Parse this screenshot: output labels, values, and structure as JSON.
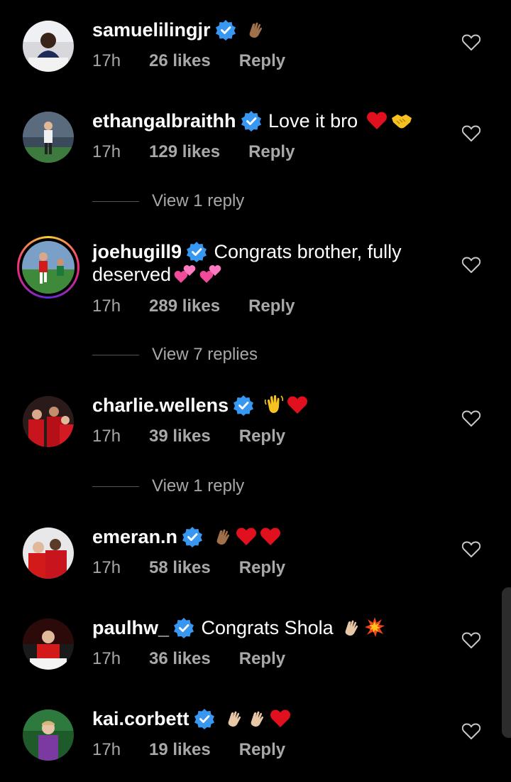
{
  "comments": [
    {
      "username": "samuelilingjr",
      "text": "",
      "emojis": [
        "clap-brown"
      ],
      "time": "17h",
      "likes": "26 likes",
      "reply": "Reply"
    },
    {
      "username": "ethangalbraithh",
      "text": "Love it bro",
      "emojis": [
        "heart",
        "handshake"
      ],
      "time": "17h",
      "likes": "129 likes",
      "reply": "Reply",
      "view_replies": "View 1 reply"
    },
    {
      "username": "joehugill9",
      "text": "Congrats brother, fully",
      "text2": "deserved",
      "emojis": [
        "two-hearts",
        "two-hearts"
      ],
      "time": "17h",
      "likes": "289 likes",
      "reply": "Reply",
      "view_replies": "View 7 replies"
    },
    {
      "username": "charlie.wellens",
      "text": "",
      "emojis": [
        "wave",
        "heart"
      ],
      "time": "17h",
      "likes": "39 likes",
      "reply": "Reply",
      "view_replies": "View 1 reply"
    },
    {
      "username": "emeran.n",
      "text": "",
      "emojis": [
        "clap-brown",
        "heart",
        "heart"
      ],
      "time": "17h",
      "likes": "58 likes",
      "reply": "Reply"
    },
    {
      "username": "paulhw_",
      "text": "Congrats Shola",
      "emojis": [
        "clap-light",
        "collision"
      ],
      "time": "17h",
      "likes": "36 likes",
      "reply": "Reply"
    },
    {
      "username": "kai.corbett",
      "text": "",
      "emojis": [
        "clap-light",
        "clap-light",
        "heart"
      ],
      "time": "17h",
      "likes": "19 likes",
      "reply": "Reply"
    }
  ],
  "colors": {
    "background": "#000000",
    "muted": "#a8a8a8",
    "verified": "#3897f0",
    "heart": "#e0101e"
  },
  "icons": {
    "verified": "verified-badge-icon",
    "like": "heart-outline-icon"
  }
}
